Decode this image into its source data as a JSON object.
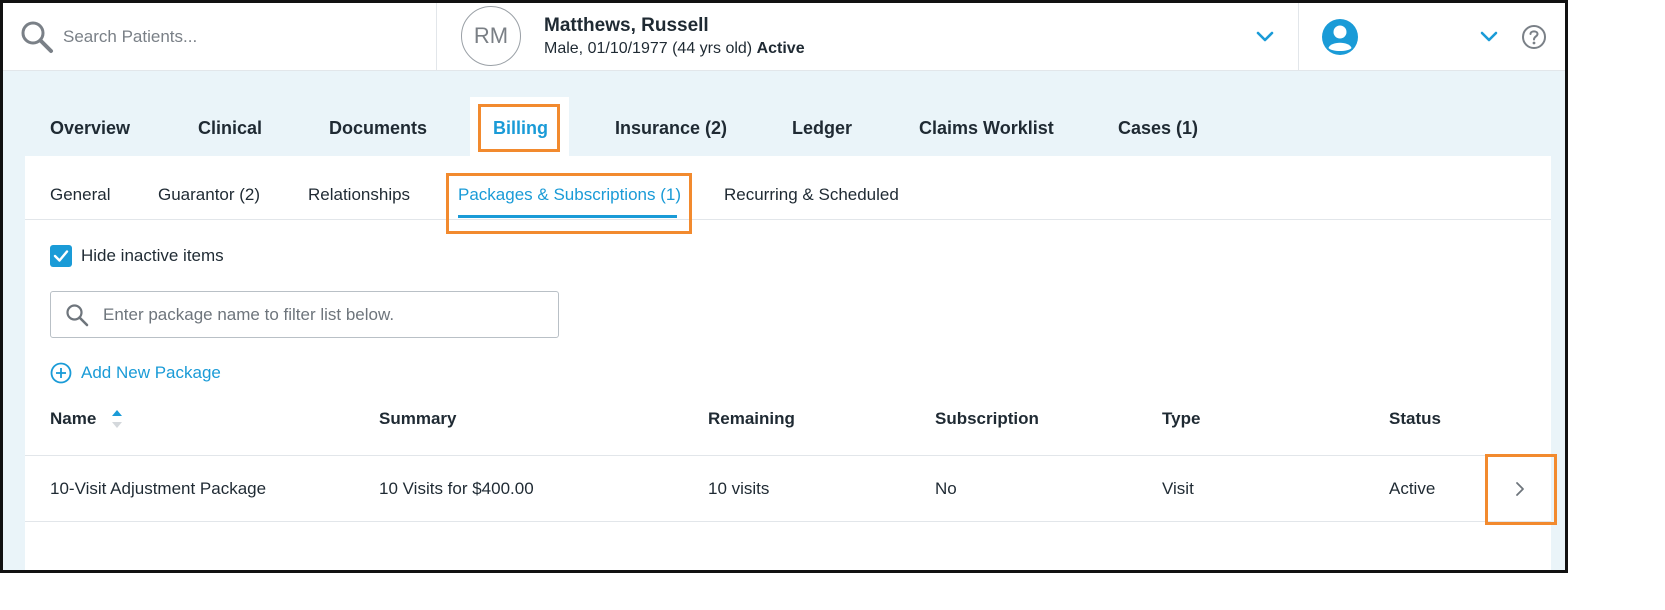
{
  "search": {
    "placeholder": "Search Patients..."
  },
  "patient": {
    "initials": "RM",
    "name": "Matthews, Russell",
    "details": "Male, 01/10/1977 (44 yrs old)",
    "status": "Active"
  },
  "tabs": [
    {
      "label": "Overview"
    },
    {
      "label": "Clinical"
    },
    {
      "label": "Documents"
    },
    {
      "label": "Billing"
    },
    {
      "label": "Insurance (2)"
    },
    {
      "label": "Ledger"
    },
    {
      "label": "Claims Worklist"
    },
    {
      "label": "Cases (1)"
    }
  ],
  "subtabs": [
    {
      "label": "General"
    },
    {
      "label": "Guarantor (2)"
    },
    {
      "label": "Relationships"
    },
    {
      "label": "Packages & Subscriptions (1)"
    },
    {
      "label": "Recurring & Scheduled"
    }
  ],
  "filters": {
    "hide_inactive_label": "Hide inactive items",
    "hide_inactive_checked": true,
    "package_filter_placeholder": "Enter package name to filter list below.",
    "add_package_label": "Add New Package"
  },
  "table": {
    "columns": [
      "Name",
      "Summary",
      "Remaining",
      "Subscription",
      "Type",
      "Status"
    ],
    "rows": [
      [
        "10-Visit Adjustment Package",
        "10 Visits for $400.00",
        "10 visits",
        "No",
        "Visit",
        "Active"
      ]
    ]
  },
  "colors": {
    "accent": "#1a9bd7",
    "highlight": "#f28a2e",
    "background": "#eaf4f9"
  }
}
